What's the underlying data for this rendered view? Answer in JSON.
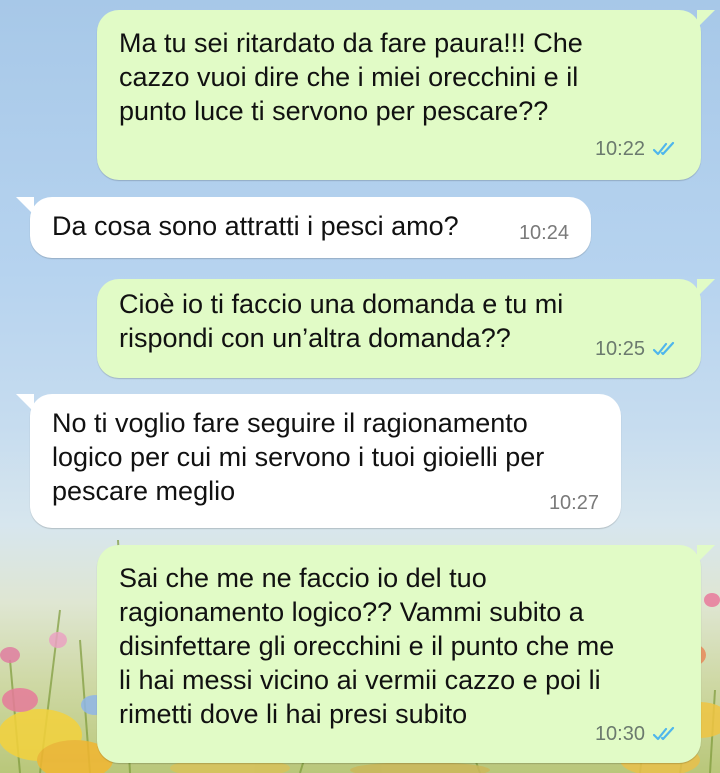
{
  "colors": {
    "outgoing_bubble": "#e1fbc6",
    "incoming_bubble": "#ffffff",
    "read_ticks": "#4fb6ec"
  },
  "messages": [
    {
      "direction": "out",
      "text": "Ma tu sei ritardato da fare paura!!! Che\ncazzo vuoi dire che i miei orecchini e il\npunto luce ti servono per pescare??",
      "time": "10:22",
      "status_icon": "double-check-read-icon"
    },
    {
      "direction": "in",
      "text": "Da cosa sono attratti i pesci amo?",
      "time": "10:24"
    },
    {
      "direction": "out",
      "text": "Cioè io ti faccio una domanda e tu mi\nrispondi con un’altra domanda??",
      "time": "10:25",
      "status_icon": "double-check-read-icon"
    },
    {
      "direction": "in",
      "text": "No ti voglio fare seguire il ragionamento\nlogico per cui mi servono i tuoi gioielli per\npescare meglio",
      "time": "10:27"
    },
    {
      "direction": "out",
      "text": "Sai che me ne faccio io del tuo\nragionamento logico?? Vammi subito a\ndisinfettare gli orecchini e il punto che me\nli hai messi vicino ai vermii cazzo e poi li\nrimetti dove li hai presi subito",
      "time": "10:30",
      "status_icon": "double-check-read-icon"
    }
  ]
}
